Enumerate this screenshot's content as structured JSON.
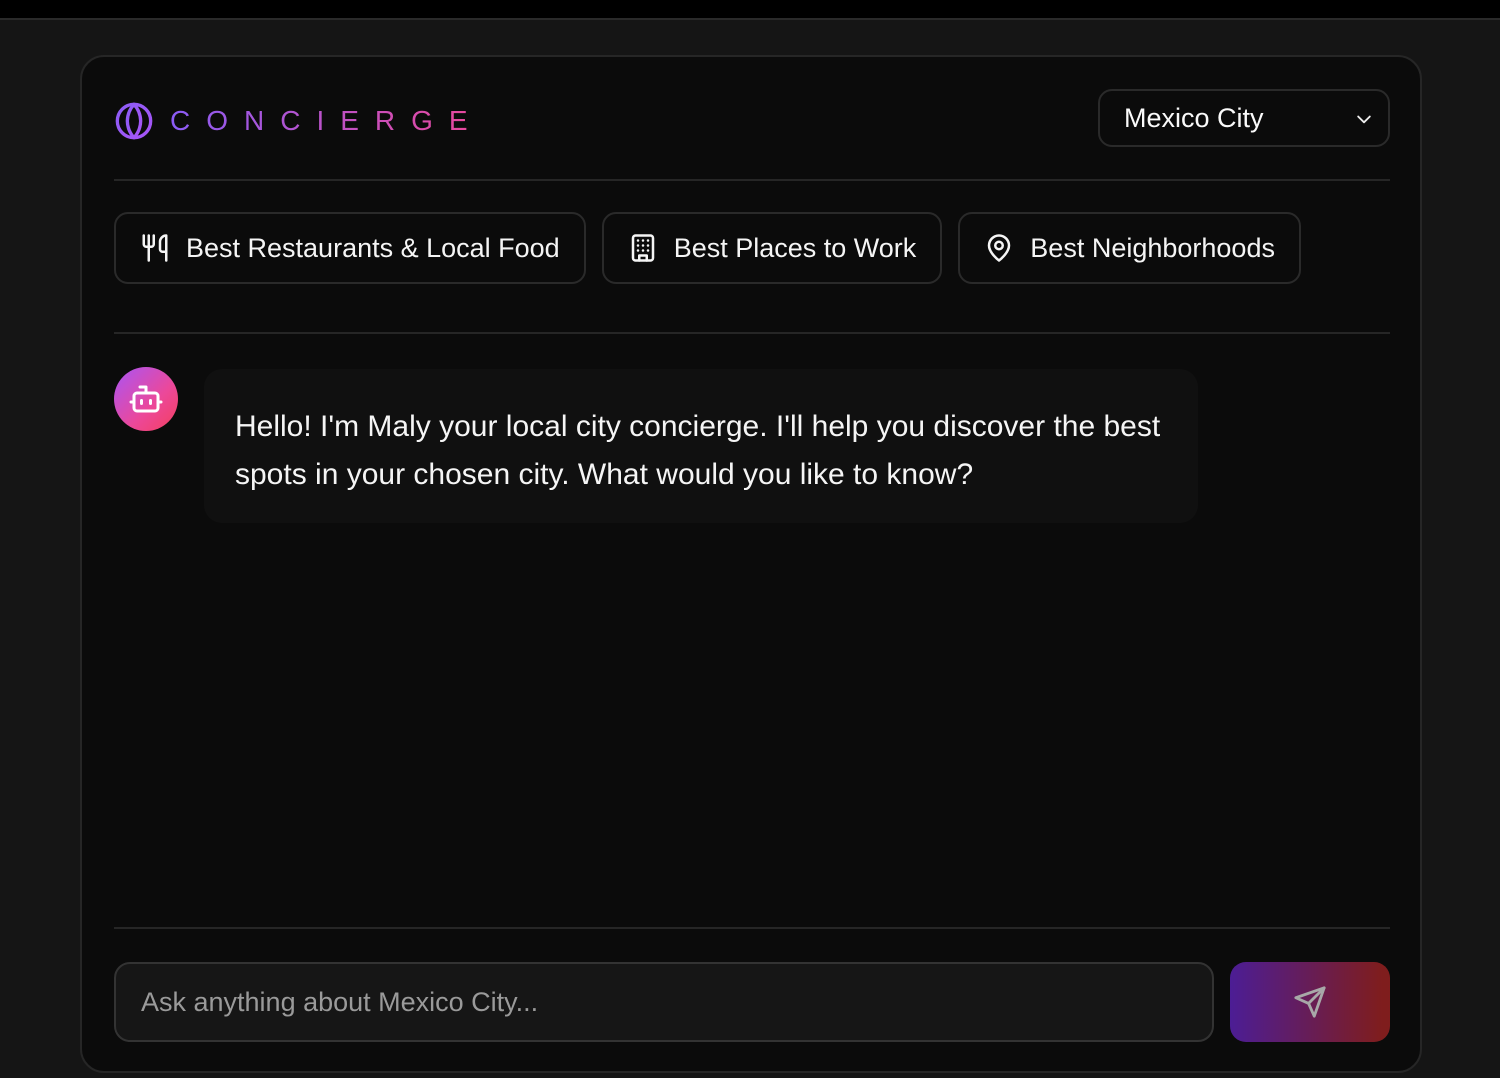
{
  "header": {
    "logo_text": "CONCIERGE",
    "city": "Mexico City"
  },
  "categories": [
    {
      "label": "Best Restaurants & Local Food",
      "icon": "utensils-icon"
    },
    {
      "label": "Best Places to Work",
      "icon": "building-icon"
    },
    {
      "label": "Best Neighborhoods",
      "icon": "map-pin-icon"
    }
  ],
  "chat": {
    "messages": [
      {
        "role": "assistant",
        "text": "Hello! I'm Maly your local city concierge. I'll help you discover the best spots in your chosen city. What would you like to know?"
      }
    ]
  },
  "composer": {
    "placeholder": "Ask anything about Mexico City...",
    "send_icon": "send-icon"
  },
  "colors": {
    "accent_start": "#8b5cf6",
    "accent_end": "#ec4899",
    "background": "#0b0b0b"
  }
}
